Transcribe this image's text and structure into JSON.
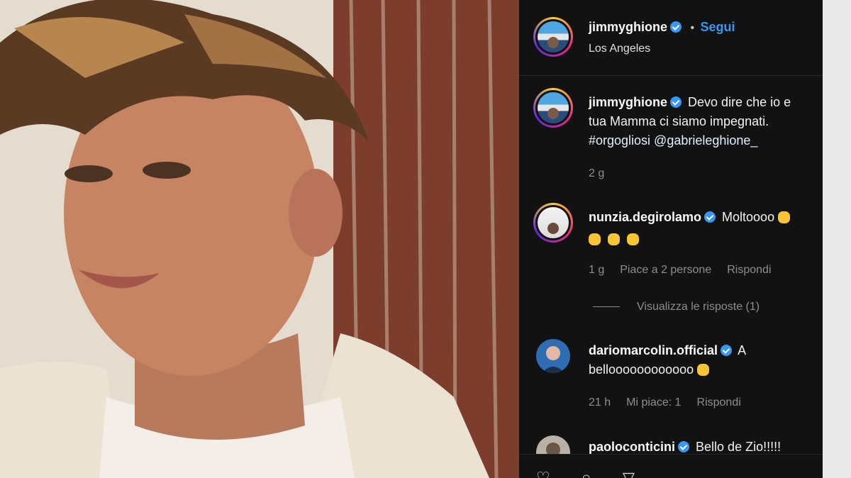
{
  "post": {
    "username": "jimmyghione",
    "follow_label": "Segui",
    "separator": "•",
    "location": "Los Angeles"
  },
  "caption": {
    "username": "jimmyghione",
    "line1": "Devo dire che io e",
    "line2": "tua Mamma ci siamo impegnati.",
    "line3": "#orgogliosi @gabrieleghione_",
    "time": "2 g"
  },
  "comments": [
    {
      "username": "nunzia.degirolamo",
      "text": "Moltoooo",
      "time": "1 g",
      "likes": "Piace a 2 persone",
      "reply": "Rispondi",
      "view_replies": "Visualizza le risposte (1)"
    },
    {
      "username": "dariomarcolin.official",
      "text1": "A",
      "text2": "belloooooooooooo",
      "time": "21 h",
      "likes": "Mi piace: 1",
      "reply": "Rispondi"
    },
    {
      "username": "paoloconticini",
      "text": "Bello de Zio!!!!!"
    }
  ],
  "icons": {
    "verified": "verified-badge-icon",
    "clap": "clapping-hands-emoji",
    "muscle": "flexed-biceps-emoji",
    "like": "heart-icon",
    "comment": "comment-icon",
    "share": "share-icon"
  },
  "colors": {
    "panel_bg": "#121212",
    "follow": "#3897f0",
    "verified": "#3897f0",
    "muted_text": "#8e8e8e"
  }
}
